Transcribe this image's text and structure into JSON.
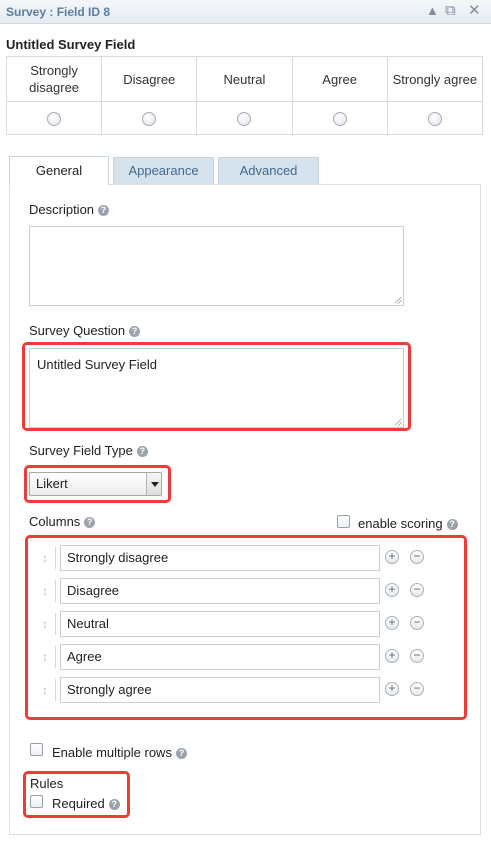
{
  "window": {
    "title": "Survey : Field ID 8"
  },
  "icons": {
    "collapse": "collapse-arrow-icon",
    "duplicate": "duplicate-icon",
    "close": "close-icon",
    "help": "help-icon",
    "drag": "drag-handle-icon",
    "add": "add-icon",
    "remove": "remove-icon"
  },
  "preview": {
    "field_label": "Untitled Survey Field",
    "columns": [
      "Strongly disagree",
      "Disagree",
      "Neutral",
      "Agree",
      "Strongly agree"
    ]
  },
  "tabs": [
    {
      "label": "General",
      "active": true
    },
    {
      "label": "Appearance",
      "active": false
    },
    {
      "label": "Advanced",
      "active": false
    }
  ],
  "general": {
    "description_label": "Description",
    "description_value": "",
    "question_label": "Survey Question",
    "question_value": "Untitled Survey Field",
    "field_type_label": "Survey Field Type",
    "field_type_value": "Likert",
    "columns_label": "Columns",
    "enable_scoring_label": "enable scoring",
    "columns": [
      "Strongly disagree",
      "Disagree",
      "Neutral",
      "Agree",
      "Strongly agree"
    ],
    "multiple_rows_label": "Enable multiple rows",
    "rules_label": "Rules",
    "required_label": "Required"
  },
  "colors": {
    "highlight": "#f13a3a",
    "title": "#5a7fa3",
    "tab_inactive_bg": "#d6e2ec"
  }
}
